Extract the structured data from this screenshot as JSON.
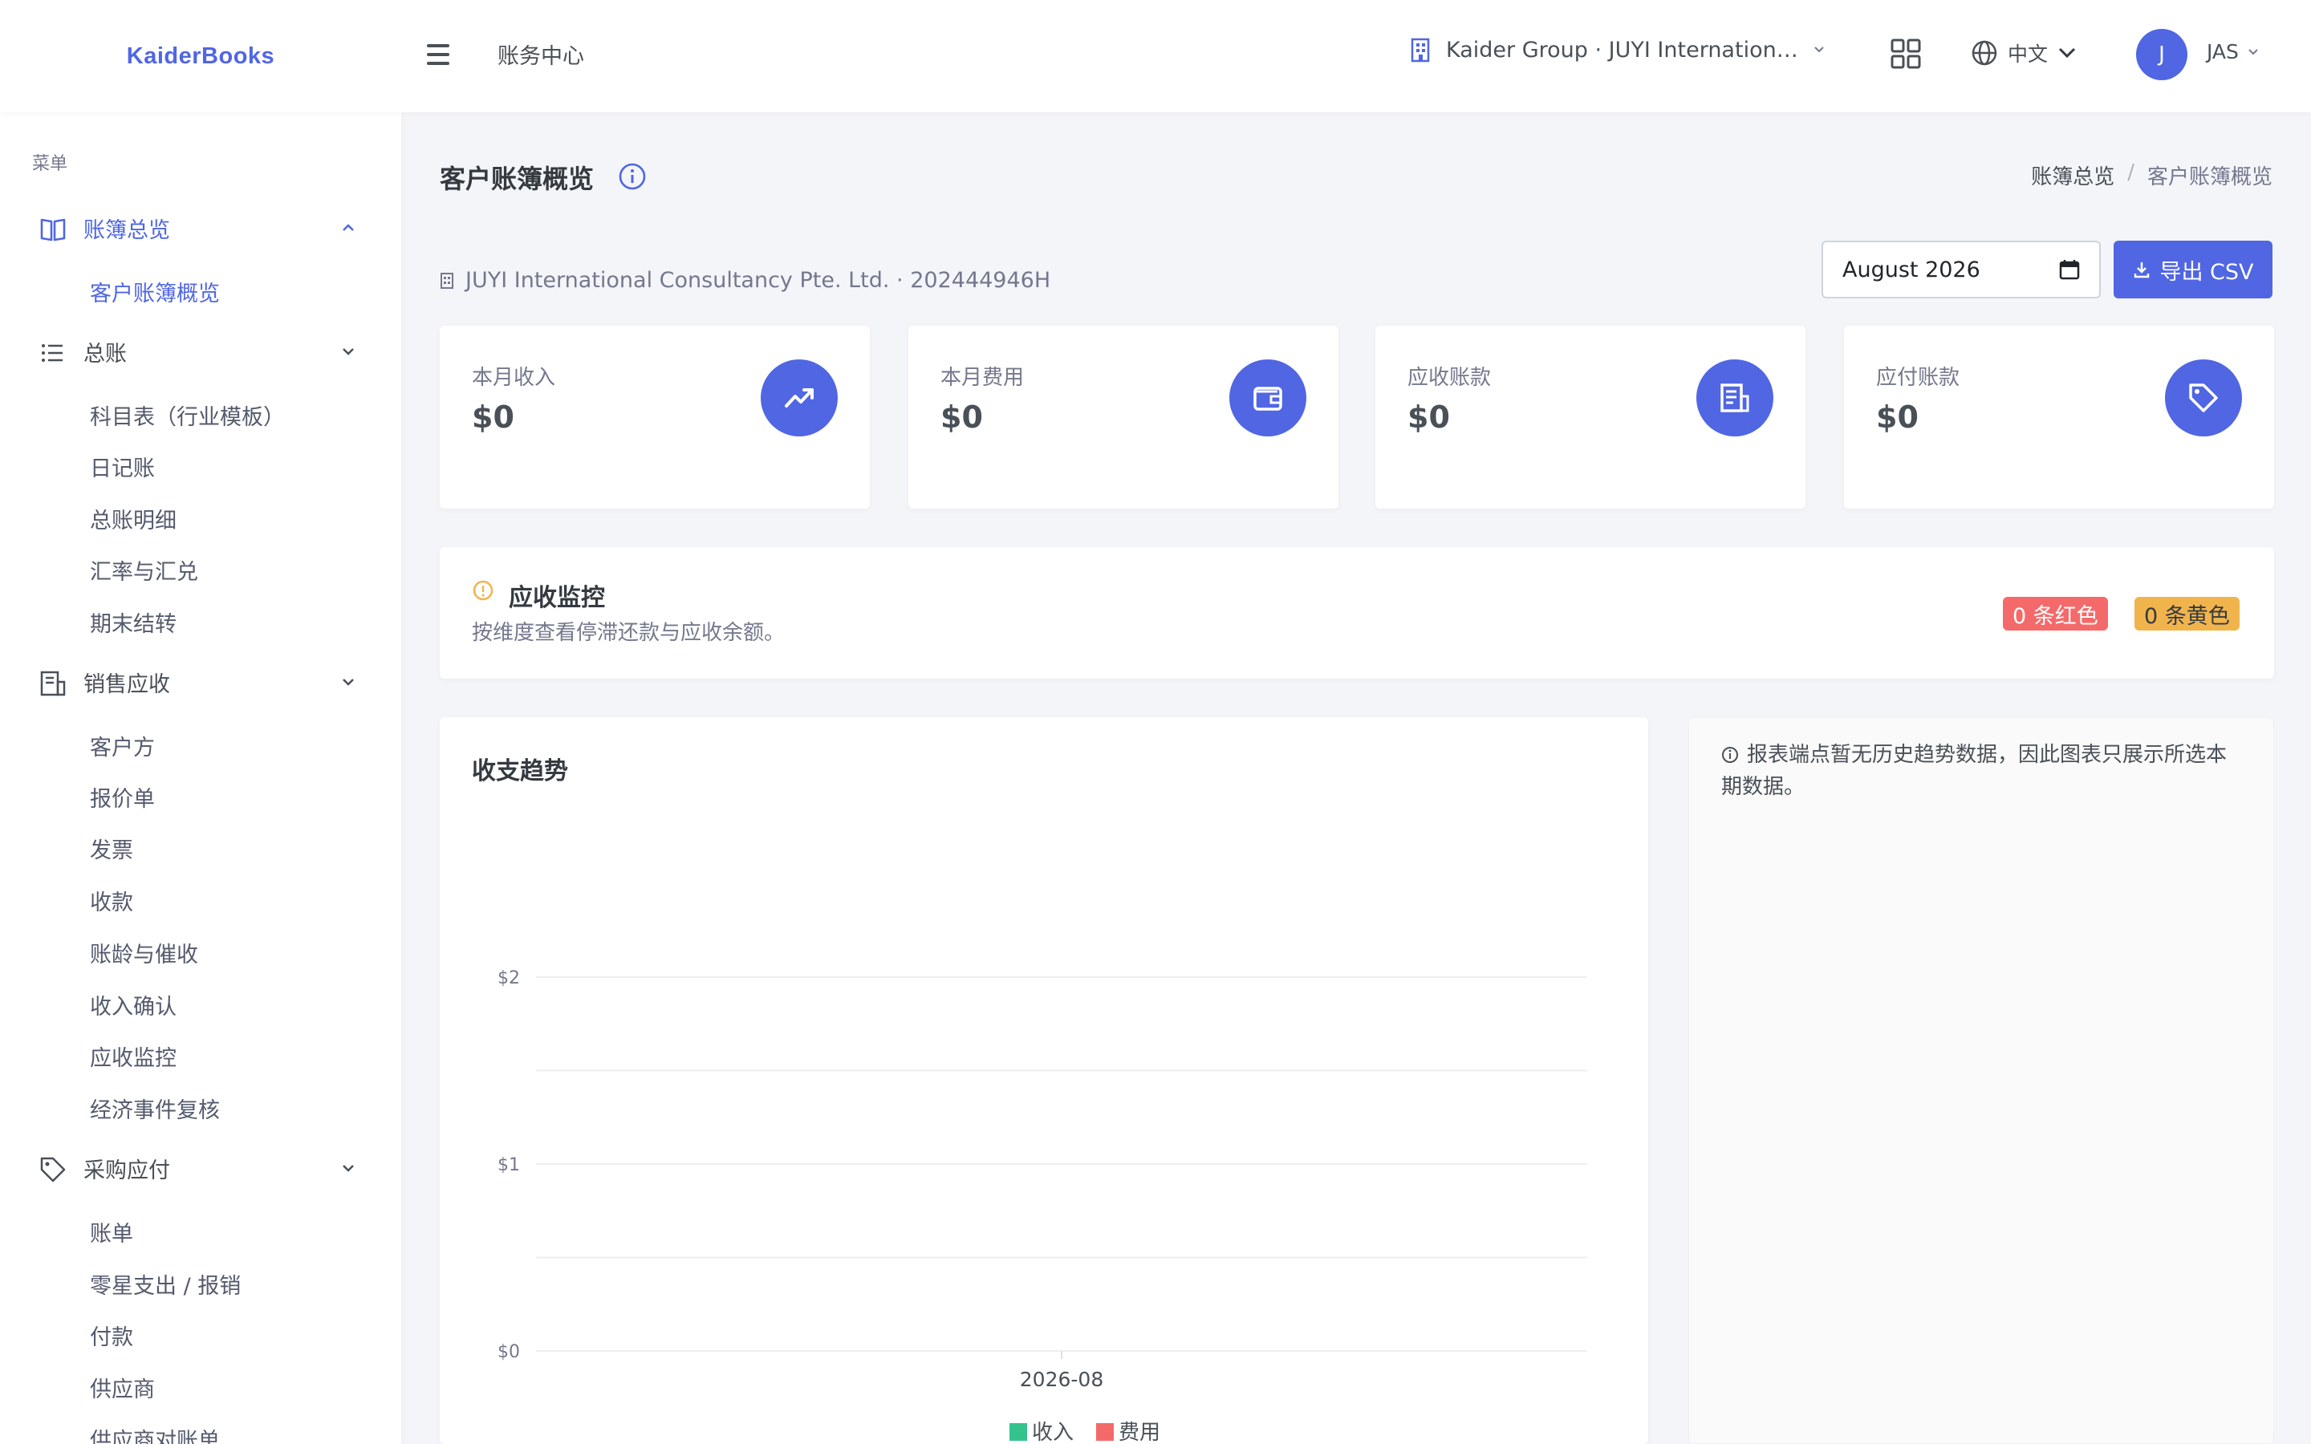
{
  "app": {
    "brand": "KaiderBooks",
    "section_title": "账务中心"
  },
  "topbar": {
    "company": "Kaider Group · JUYI International Consultancy Pte. Ltd.",
    "language": "中文",
    "avatar_initial": "J",
    "user_name": "JAS"
  },
  "sidebar": {
    "menu_title": "菜单",
    "groups": [
      {
        "label": "账簿总览",
        "icon": "book-open-icon",
        "expanded": true,
        "items": [
          "客户账簿概览"
        ]
      },
      {
        "label": "总账",
        "icon": "list-icon",
        "expanded": true,
        "items": [
          "科目表（行业模板）",
          "日记账",
          "总账明细",
          "汇率与汇兑",
          "期末结转"
        ]
      },
      {
        "label": "销售应收",
        "icon": "receipt-icon",
        "expanded": true,
        "items": [
          "客户方",
          "报价单",
          "发票",
          "收款",
          "账龄与催收",
          "收入确认",
          "应收监控",
          "经济事件复核"
        ]
      },
      {
        "label": "采购应付",
        "icon": "tag-icon",
        "expanded": true,
        "items": [
          "账单",
          "零星支出 / 报销",
          "付款",
          "供应商",
          "供应商对账单"
        ]
      }
    ],
    "active_item": "客户账簿概览"
  },
  "page": {
    "title": "客户账簿概览",
    "breadcrumb": [
      "账簿总览",
      "客户账簿概览"
    ],
    "entity": "JUYI International Consultancy Pte. Ltd. · 202444946H",
    "month_value": "August 2026",
    "export_label": "导出 CSV"
  },
  "stats": [
    {
      "label": "本月收入",
      "value": "$0",
      "icon": "trending-up-icon"
    },
    {
      "label": "本月费用",
      "value": "$0",
      "icon": "wallet-icon"
    },
    {
      "label": "应收账款",
      "value": "$0",
      "icon": "receipt-icon"
    },
    {
      "label": "应付账款",
      "value": "$0",
      "icon": "tag-icon"
    }
  ],
  "monitor": {
    "title": "应收监控",
    "description": "按维度查看停滞还款与应收余额。",
    "red_badge": "0 条红色",
    "yellow_badge": "0 条黄色"
  },
  "trend": {
    "title": "收支趋势",
    "note": "报表端点暂无历史趋势数据，因此图表只展示所选本期数据。"
  },
  "colors": {
    "accent": "#5066e3",
    "income": "#34c38f",
    "expense": "#f46a6a",
    "warning": "#f1b44c"
  },
  "chart_data": {
    "type": "bar",
    "categories": [
      "2026-08"
    ],
    "series": [
      {
        "name": "收入",
        "values": [
          0
        ]
      },
      {
        "name": "费用",
        "values": [
          0
        ]
      }
    ],
    "ylim": [
      0,
      2
    ],
    "yticks": [
      "$2",
      "$1",
      "$0"
    ],
    "grid": true,
    "legend_position": "bottom"
  }
}
